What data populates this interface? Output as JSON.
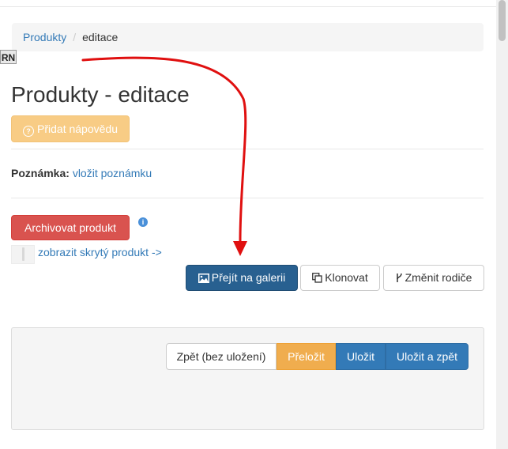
{
  "breadcrumb": {
    "parent": "Produkty",
    "separator": "/",
    "current": "editace"
  },
  "rn_tag": "RN",
  "page_title": "Produkty - editace",
  "help_button": {
    "icon": "question-circle-icon",
    "label": "Přidat nápovědu"
  },
  "note": {
    "label": "Poznámka:",
    "link": "vložit poznámku"
  },
  "archive_button": "Archivovat produkt",
  "info_icon": "i",
  "hidden_product_link": "zobrazit skrytý produkt ->",
  "actions": {
    "gallery": "Přejít na galerii",
    "clone": "Klonovat",
    "change_parent": "Změnit rodiče"
  },
  "footer_buttons": {
    "back": "Zpět (bez uložení)",
    "translate": "Přeložit",
    "save": "Uložit",
    "save_back": "Uložit a zpět"
  },
  "colors": {
    "link": "#337ab7",
    "primary_dark": "#286090",
    "danger": "#d9534f",
    "warning": "#f0ad4e",
    "annotation_arrow": "#e01010"
  }
}
